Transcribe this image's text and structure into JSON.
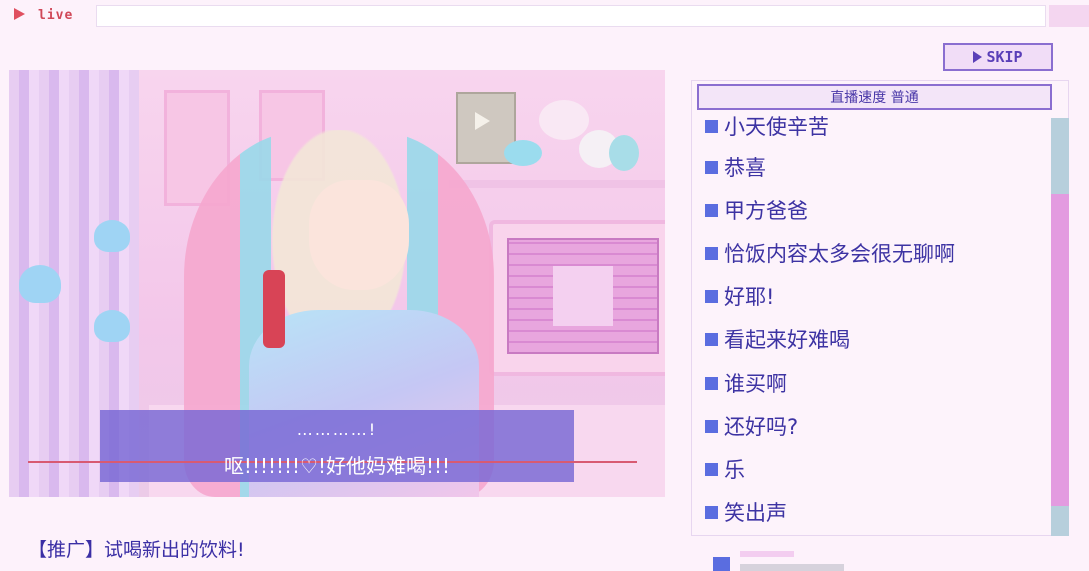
{
  "topbar": {
    "live_label": "live"
  },
  "controls": {
    "skip_label": "SKIP"
  },
  "stream": {
    "subtitle_line1": "…………!",
    "subtitle_line2": "呕!!!!!!!♡!好他妈难喝!!!"
  },
  "caption": "【推广】试喝新出的饮料!",
  "chat": {
    "header": "直播速度 普通",
    "messages": [
      "小天使辛苦",
      "恭喜",
      "甲方爸爸",
      "恰饭内容太多会很无聊啊",
      "好耶!",
      "看起来好难喝",
      "谁买啊",
      "还好吗?",
      "乐",
      "笑出声"
    ]
  },
  "colors": {
    "accent": "#8a6ed0",
    "chat_text": "#3d33a3",
    "bullet": "#5a6de0",
    "live_red": "#e05060"
  }
}
